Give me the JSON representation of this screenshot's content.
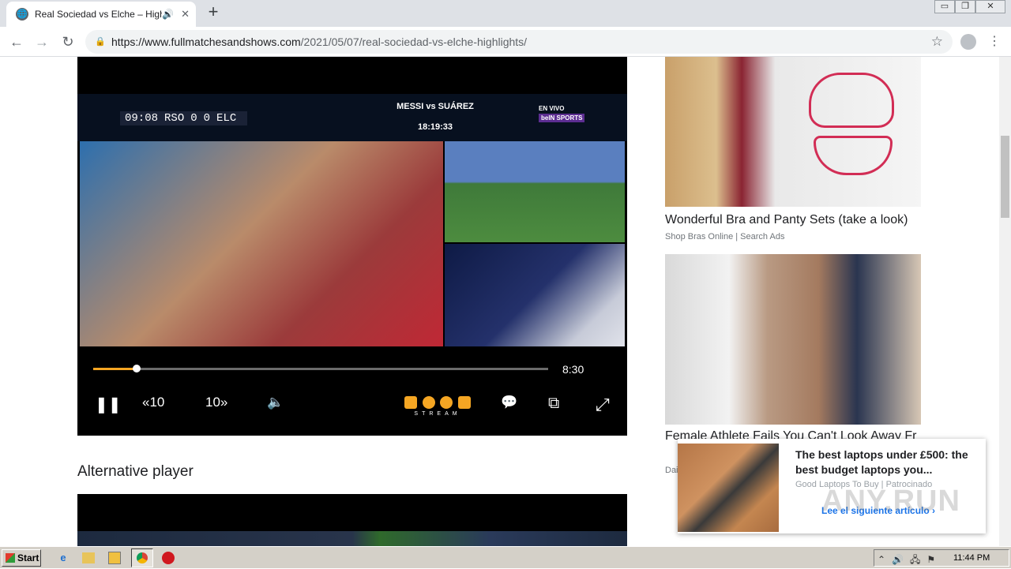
{
  "browser": {
    "tab_title": "Real Sociedad vs Elche – Highlig",
    "new_tab": "+",
    "tab_close": "✕",
    "speaker": "🔊",
    "favicon": "🌐",
    "url_host": "https://www.fullmatchesandshows.com",
    "url_path": "/2021/05/07/real-sociedad-vs-elche-highlights/",
    "back": "←",
    "forward": "→",
    "reload": "↻",
    "lock": "🔒",
    "star": "☆",
    "menu": "⋮",
    "win_min": "▭",
    "win_restore": "❐",
    "win_close": "✕"
  },
  "player": {
    "clock": "09:08",
    "home_team": "RSO",
    "home_score": "0",
    "away_score": "0",
    "away_team": "ELC",
    "match_tag": "MESSI vs SUÁREZ",
    "match_time": "18:19:33",
    "broadcaster_live": "EN VIVO",
    "broadcaster": "beIN SPORTS",
    "duration": "8:30",
    "progress_fraction": 0.095,
    "controls": {
      "pause": "❚❚",
      "rewind": "«10",
      "forward": "10»",
      "volume": "🔈",
      "stream_label": "STREAM",
      "captions": "💬",
      "pip": "⧉",
      "fullscreen": "⤢"
    }
  },
  "page": {
    "alt_player_label": "Alternative player"
  },
  "ads": [
    {
      "title": "Wonderful Bra and Panty Sets (take a look)",
      "source": "Shop Bras Online | Search Ads"
    },
    {
      "title": "Female Athlete Fails You Can't Look Away Fr",
      "source": "Dai"
    }
  ],
  "popup": {
    "title": "The best laptops under £500: the best budget laptops you...",
    "source": "Good Laptops To Buy | Patrocinado",
    "cta": "Lee el siguiente artículo ›"
  },
  "watermark": "ANY.RUN",
  "taskbar": {
    "start": "Start",
    "time": "11:44 PM",
    "tray_icons": "⌃🔊🖧⚑"
  },
  "colors": {
    "accent_orange": "#f5a623",
    "link_blue": "#1a73e8"
  }
}
